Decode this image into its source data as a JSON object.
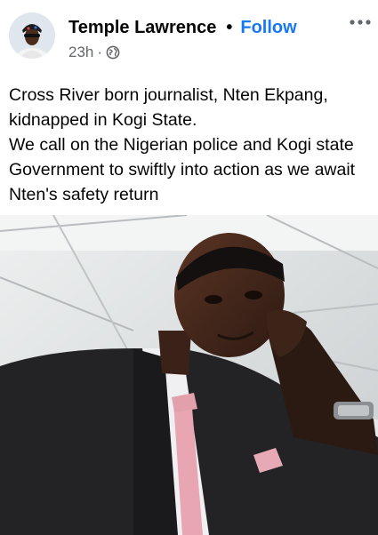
{
  "post": {
    "author": "Temple Lawrence",
    "separator": "•",
    "follow_label": "Follow",
    "time": "23h",
    "meta_separator": "·",
    "privacy_icon": "globe-icon",
    "more_icon": "more-horizontal-icon",
    "text_lines": [
      "Cross River born journalist, Nten Ekpang, kidnapped in Kogi State.",
      "We call on the Nigerian police and Kogi state Government to swiftly into action as we await Nten's safety return"
    ],
    "photo_description_icon": "photo"
  },
  "colors": {
    "follow": "#1877f2",
    "text": "#050505",
    "meta": "#65676b"
  }
}
